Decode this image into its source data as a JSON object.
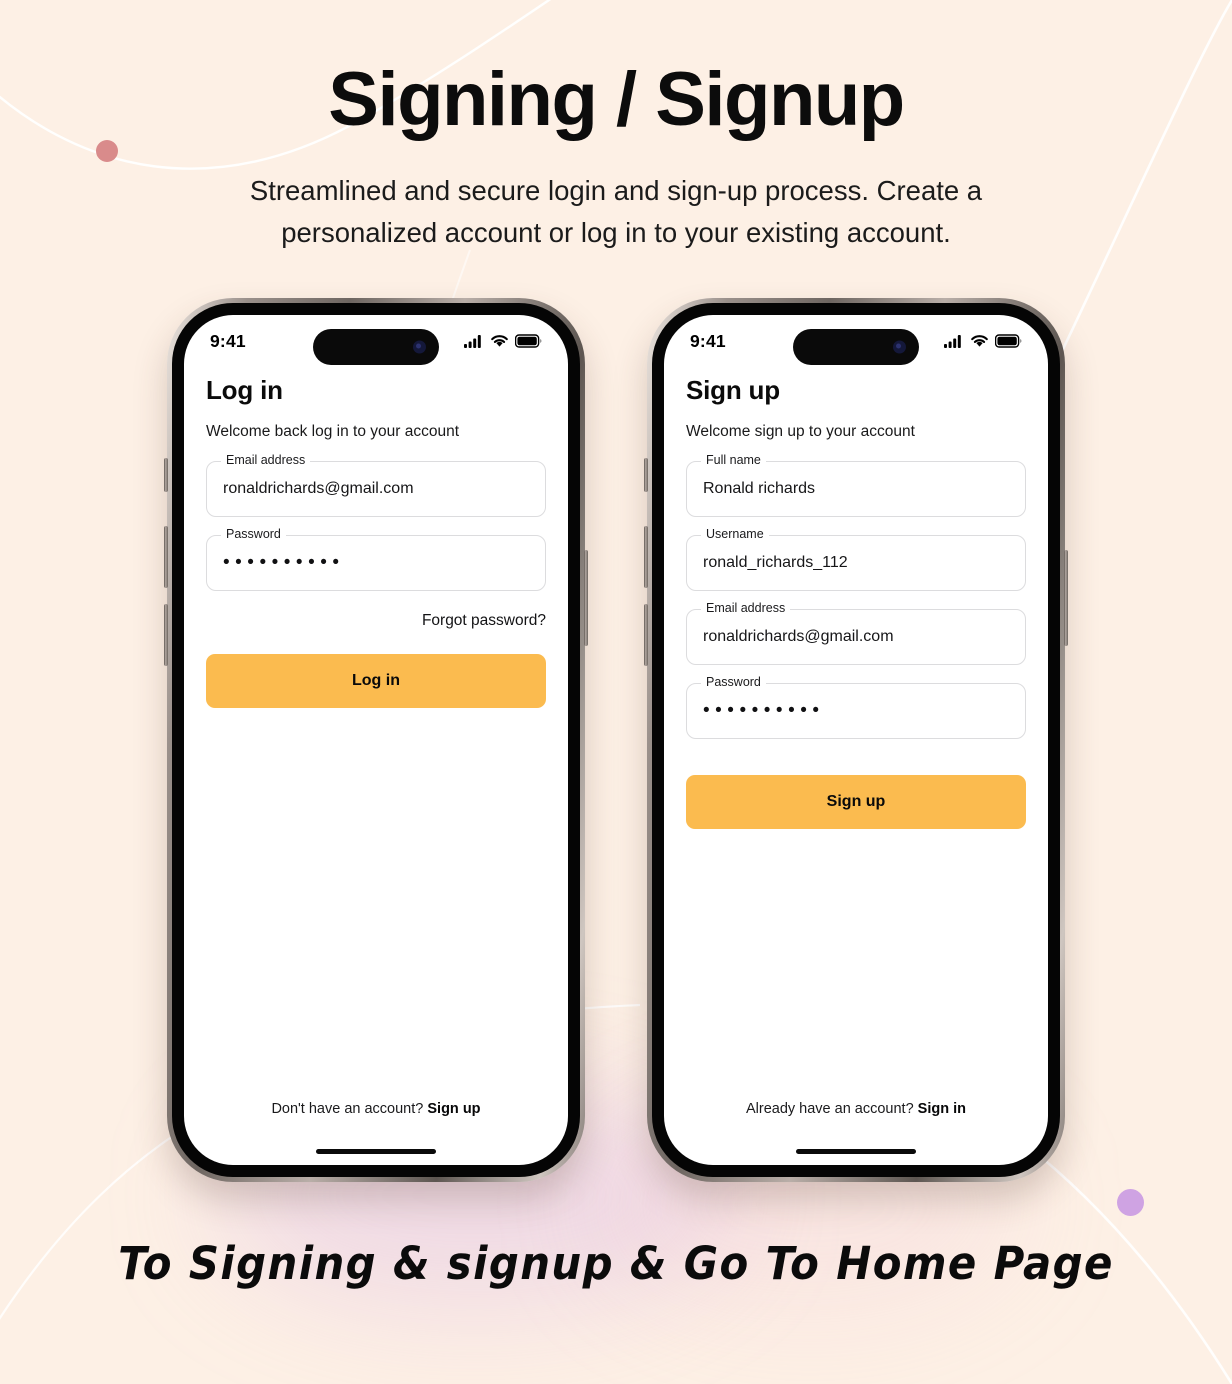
{
  "page": {
    "title": "Signing / Signup",
    "subtitle": "Streamlined and secure login and sign-up process. Create a personalized account or log in to your existing account.",
    "caption": "To Signing & signup & Go To Home Page",
    "background_color": "#FDF0E5",
    "accent_color": "#FBBB4F",
    "dot_rose_color": "#D98B8B",
    "dot_purple_color": "#CFA3E3"
  },
  "login_screen": {
    "status": {
      "time": "9:41",
      "cellular": "signal-bars-icon",
      "wifi": "wifi-icon",
      "battery": "battery-icon"
    },
    "title": "Log in",
    "subtitle": "Welcome back log in to your account",
    "fields": [
      {
        "label": "Email address",
        "value": "ronaldrichards@gmail.com",
        "type": "email",
        "placeholder": "Email address"
      },
      {
        "label": "Password",
        "value": "••••••••••",
        "type": "password",
        "placeholder": "Password"
      }
    ],
    "forgot_label": "Forgot password?",
    "submit_label": "Log in",
    "footer_text": "Don't have an account?",
    "footer_link": "Sign up"
  },
  "signup_screen": {
    "status": {
      "time": "9:41",
      "cellular": "signal-bars-icon",
      "wifi": "wifi-icon",
      "battery": "battery-icon"
    },
    "title": "Sign up",
    "subtitle": "Welcome sign up to your account",
    "fields": [
      {
        "label": "Full name",
        "value": "Ronald richards",
        "type": "text",
        "placeholder": "Full name"
      },
      {
        "label": "Username",
        "value": "ronald_richards_112",
        "type": "text",
        "placeholder": "Username"
      },
      {
        "label": "Email address",
        "value": "ronaldrichards@gmail.com",
        "type": "email",
        "placeholder": "Email address"
      },
      {
        "label": "Password",
        "value": "••••••••••",
        "type": "password",
        "placeholder": "Password"
      }
    ],
    "submit_label": "Sign up",
    "footer_text": "Already have an account?",
    "footer_link": "Sign in"
  }
}
